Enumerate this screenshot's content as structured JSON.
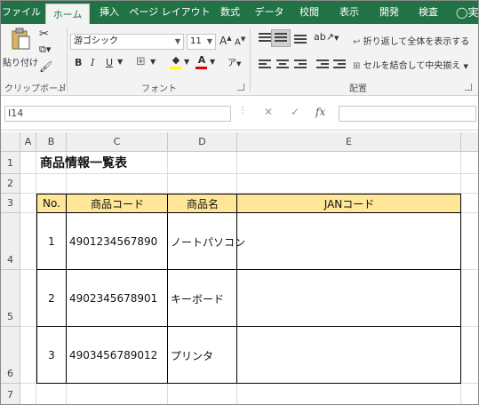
{
  "ribbon": {
    "tabs": [
      "ファイル",
      "ホーム",
      "挿入",
      "ページ レイアウト",
      "数式",
      "データ",
      "校閲",
      "表示",
      "開発",
      "検査"
    ],
    "tell_me_partial": "実",
    "clipboard": {
      "paste_label": "貼り付け",
      "group_label": "クリップボード"
    },
    "font": {
      "name": "游ゴシック",
      "size": "11",
      "bold": "B",
      "italic": "I",
      "underline": "U",
      "grow": "A",
      "shrink": "A",
      "phonetic": "ア",
      "group_label": "フォント"
    },
    "alignment": {
      "wrap_text": "折り返して全体を表示する",
      "merge_center": "セルを結合して中央揃え",
      "group_label": "配置"
    }
  },
  "formula_bar": {
    "name_box": "I14",
    "cancel": "✕",
    "enter": "✓",
    "fx": "fx",
    "content": ""
  },
  "sheet": {
    "columns": [
      "A",
      "B",
      "C",
      "D",
      "E"
    ],
    "rows": [
      "1",
      "2",
      "3",
      "4",
      "5",
      "6",
      "7"
    ],
    "title": "商品情報一覧表",
    "table": {
      "headers": [
        "No.",
        "商品コード",
        "商品名",
        "JANコード"
      ],
      "rows": [
        {
          "no": "1",
          "code": "4901234567890",
          "name": "ノートパソコン",
          "jan": ""
        },
        {
          "no": "2",
          "code": "4902345678901",
          "name": "キーボード",
          "jan": ""
        },
        {
          "no": "3",
          "code": "4903456789012",
          "name": "プリンタ",
          "jan": ""
        }
      ]
    }
  },
  "colors": {
    "accent": "#217346",
    "table_header": "#ffe699"
  }
}
